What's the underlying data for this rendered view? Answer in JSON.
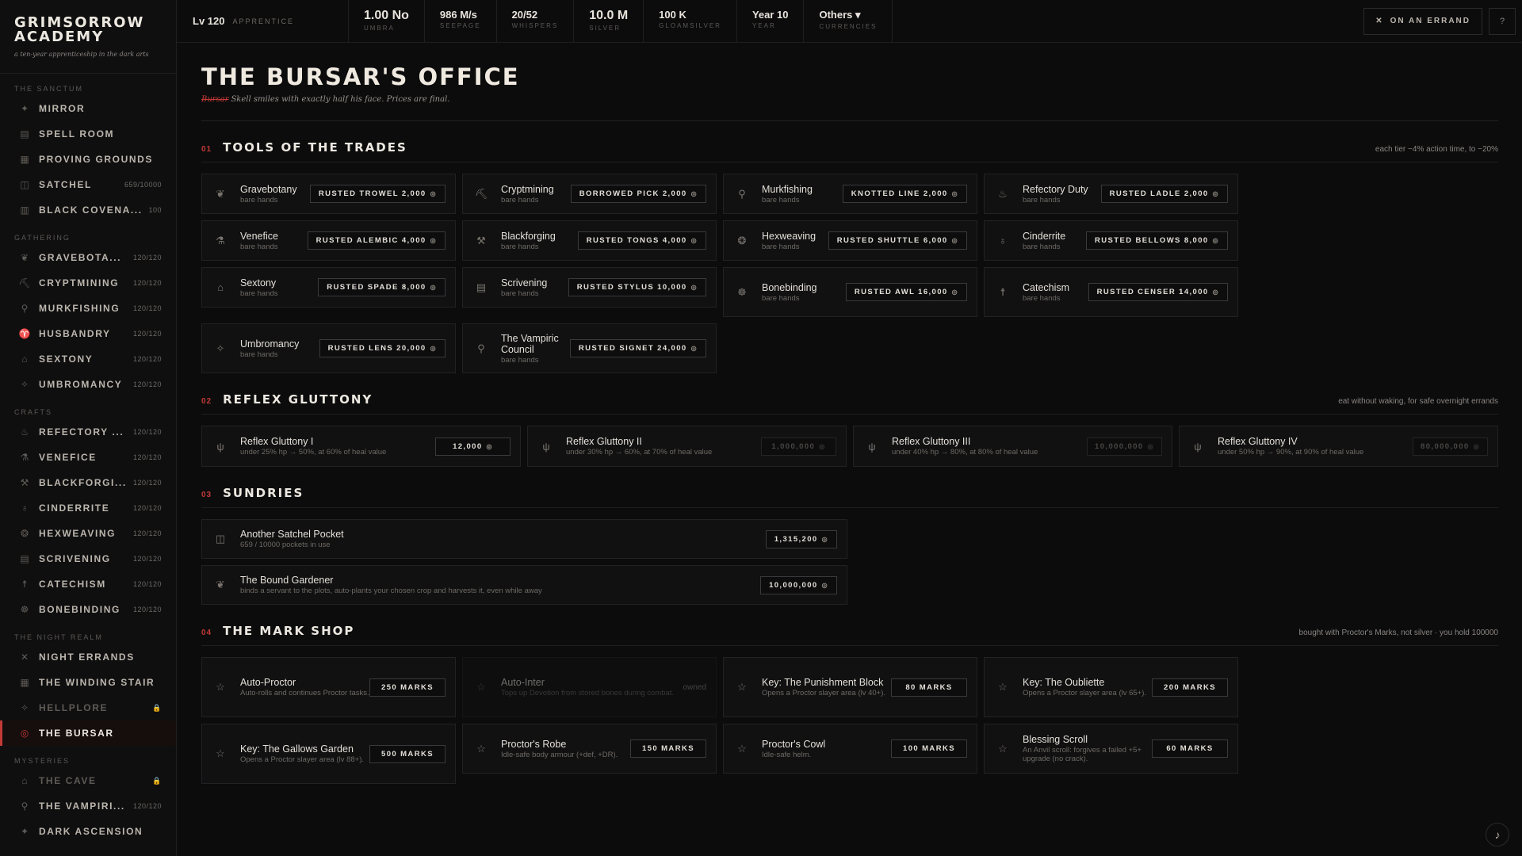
{
  "brand": {
    "title_line1": "GRIMSORROW",
    "title_line2": "ACADEMY",
    "subtitle": "a ten-year apprenticeship in the dark arts"
  },
  "sidebar": {
    "sections": [
      {
        "label": "THE SANCTUM",
        "items": [
          {
            "label": "MIRROR",
            "count": "",
            "icon": "✦"
          },
          {
            "label": "SPELL ROOM",
            "count": "",
            "icon": "▤"
          },
          {
            "label": "PROVING GROUNDS",
            "count": "",
            "icon": "▦"
          },
          {
            "label": "SATCHEL",
            "count": "659/10000",
            "icon": "◫"
          },
          {
            "label": "BLACK COVENA...",
            "count": "100",
            "icon": "▥"
          }
        ]
      },
      {
        "label": "GATHERING",
        "items": [
          {
            "label": "GRAVEBOTA...",
            "count": "120/120",
            "icon": "❦"
          },
          {
            "label": "CRYPTMINING",
            "count": "120/120",
            "icon": "⛏"
          },
          {
            "label": "MURKFISHING",
            "count": "120/120",
            "icon": "⚲"
          },
          {
            "label": "HUSBANDRY",
            "count": "120/120",
            "icon": "♈"
          },
          {
            "label": "SEXTONY",
            "count": "120/120",
            "icon": "⌂"
          },
          {
            "label": "UMBROMANCY",
            "count": "120/120",
            "icon": "✧"
          }
        ]
      },
      {
        "label": "CRAFTS",
        "items": [
          {
            "label": "REFECTORY ...",
            "count": "120/120",
            "icon": "♨"
          },
          {
            "label": "VENEFICE",
            "count": "120/120",
            "icon": "⚗"
          },
          {
            "label": "BLACKFORGI...",
            "count": "120/120",
            "icon": "⚒"
          },
          {
            "label": "CINDERRITE",
            "count": "120/120",
            "icon": "♁"
          },
          {
            "label": "HEXWEAVING",
            "count": "120/120",
            "icon": "❂"
          },
          {
            "label": "SCRIVENING",
            "count": "120/120",
            "icon": "▤"
          },
          {
            "label": "CATECHISM",
            "count": "120/120",
            "icon": "☨"
          },
          {
            "label": "BONEBINDING",
            "count": "120/120",
            "icon": "☸"
          }
        ]
      },
      {
        "label": "THE NIGHT REALM",
        "items": [
          {
            "label": "NIGHT ERRANDS",
            "count": "",
            "icon": "✕"
          },
          {
            "label": "THE WINDING STAIR",
            "count": "",
            "icon": "▦"
          },
          {
            "label": "HELLPLORE",
            "count": "🔒",
            "icon": "✧",
            "locked": true
          },
          {
            "label": "THE BURSAR",
            "count": "",
            "icon": "◎",
            "active": true
          }
        ]
      },
      {
        "label": "MYSTERIES",
        "items": [
          {
            "label": "THE CAVE",
            "count": "🔒",
            "icon": "⌂",
            "locked": true
          },
          {
            "label": "THE VAMPIRI...",
            "count": "120/120",
            "icon": "⚲"
          },
          {
            "label": "DARK ASCENSION",
            "count": "",
            "icon": "✦"
          }
        ]
      }
    ]
  },
  "topbar": {
    "level": "Lv 120",
    "rank": "APPRENTICE",
    "stats": [
      {
        "value": "1.00 No",
        "label": "UMBRA",
        "big": true
      },
      {
        "value": "986 M/s",
        "label": "SEEPAGE"
      },
      {
        "value": "20/52",
        "label": "WHISPERS"
      },
      {
        "value": "10.0 M",
        "label": "SILVER",
        "big": true
      },
      {
        "value": "100 K",
        "label": "GLOAMSILVER"
      },
      {
        "value": "Year 10",
        "label": "YEAR"
      },
      {
        "value": "Others ▾",
        "label": "CURRENCIES"
      }
    ],
    "errand_label": "ON AN ERRAND",
    "help_label": "?"
  },
  "page": {
    "title": "THE BURSAR'S OFFICE",
    "sub_strike": "Bursar",
    "sub_text": "Skell smiles with exactly half his face. Prices are final."
  },
  "tools": {
    "num": "01",
    "title": "TOOLS OF THE TRADES",
    "note": "each tier −4% action time, to −20%",
    "items": [
      {
        "name": "Gravebotany",
        "desc": "bare hands",
        "btn": "RUSTED TROWEL 2,000",
        "icon": "❦"
      },
      {
        "name": "Cryptmining",
        "desc": "bare hands",
        "btn": "BORROWED PICK 2,000",
        "icon": "⛏"
      },
      {
        "name": "Murkfishing",
        "desc": "bare hands",
        "btn": "KNOTTED LINE 2,000",
        "icon": "⚲"
      },
      {
        "name": "Refectory Duty",
        "desc": "bare hands",
        "btn": "RUSTED LADLE 2,000",
        "icon": "♨"
      },
      {
        "name": "Venefice",
        "desc": "bare hands",
        "btn": "RUSTED ALEMBIC 4,000",
        "icon": "⚗"
      },
      {
        "name": "Blackforging",
        "desc": "bare hands",
        "btn": "RUSTED TONGS 4,000",
        "icon": "⚒"
      },
      {
        "name": "Hexweaving",
        "desc": "bare hands",
        "btn": "RUSTED SHUTTLE 6,000",
        "icon": "❂"
      },
      {
        "name": "Cinderrite",
        "desc": "bare hands",
        "btn": "RUSTED BELLOWS 8,000",
        "icon": "♁"
      },
      {
        "name": "Sextony",
        "desc": "bare hands",
        "btn": "RUSTED SPADE 8,000",
        "icon": "⌂"
      },
      {
        "name": "Scrivening",
        "desc": "bare hands",
        "btn": "RUSTED STYLUS 10,000",
        "icon": "▤"
      },
      {
        "name": "Bonebinding",
        "desc": "bare hands",
        "btn": "RUSTED AWL 16,000",
        "icon": "☸",
        "tall": true
      },
      {
        "name": "Catechism",
        "desc": "bare hands",
        "btn": "RUSTED CENSER 14,000",
        "icon": "☨",
        "tall": true
      },
      {
        "name": "Umbromancy",
        "desc": "bare hands",
        "btn": "RUSTED LENS 20,000",
        "icon": "✧",
        "tall": true
      },
      {
        "name": "The Vampiric Council",
        "desc": "bare hands",
        "btn": "RUSTED SIGNET 24,000",
        "icon": "⚲",
        "tall": true
      }
    ]
  },
  "gluttony": {
    "num": "02",
    "title": "REFLEX GLUTTONY",
    "note": "eat without waking, for safe overnight errands",
    "items": [
      {
        "name": "Reflex Gluttony I",
        "desc": "under 25% hp → 50%, at 60% of heal value",
        "btn": "12,000",
        "dim": false
      },
      {
        "name": "Reflex Gluttony II",
        "desc": "under 30% hp → 60%, at 70% of heal value",
        "btn": "1,000,000",
        "dim": true
      },
      {
        "name": "Reflex Gluttony III",
        "desc": "under 40% hp → 80%, at 80% of heal value",
        "btn": "10,000,000",
        "dim": true
      },
      {
        "name": "Reflex Gluttony IV",
        "desc": "under 50% hp → 90%, at 90% of heal value",
        "btn": "80,000,000",
        "dim": true
      }
    ]
  },
  "sundries": {
    "num": "03",
    "title": "SUNDRIES",
    "items": [
      {
        "name": "Another Satchel Pocket",
        "desc": "659 / 10000 pockets in use",
        "btn": "1,315,200",
        "icon": "◫"
      },
      {
        "name": "The Bound Gardener",
        "desc": "binds a servant to the plots, auto-plants your chosen crop and harvests it, even while away",
        "btn": "10,000,000",
        "icon": "❦"
      }
    ]
  },
  "shop": {
    "num": "04",
    "title": "THE MARK SHOP",
    "note": "bought with Proctor's Marks, not silver · you hold 100000",
    "items": [
      {
        "name": "Auto-Proctor",
        "desc": "Auto-rolls and continues Proctor tasks.",
        "btn": "250 MARKS"
      },
      {
        "name": "Auto-Inter",
        "desc": "Tops up Devotion from stored bones during combat.",
        "btn": "",
        "owned": "owned"
      },
      {
        "name": "Key: The Punishment Block",
        "desc": "Opens a Proctor slayer area (lv 40+).",
        "btn": "80 MARKS"
      },
      {
        "name": "Key: The Oubliette",
        "desc": "Opens a Proctor slayer area (lv 65+).",
        "btn": "200 MARKS"
      },
      {
        "name": "Key: The Gallows Garden",
        "desc": "Opens a Proctor slayer area (lv 88+).",
        "btn": "500 MARKS"
      },
      {
        "name": "Proctor's Robe",
        "desc": "Idle-safe body armour (+def, +DR).",
        "btn": "150 MARKS",
        "short": true
      },
      {
        "name": "Proctor's Cowl",
        "desc": "Idle-safe helm.",
        "btn": "100 MARKS",
        "short": true
      },
      {
        "name": "Blessing Scroll",
        "desc": "An Anvil scroll: forgives a failed +5+ upgrade (no crack).",
        "btn": "60 MARKS",
        "short": true
      }
    ]
  },
  "music_label": "♪"
}
